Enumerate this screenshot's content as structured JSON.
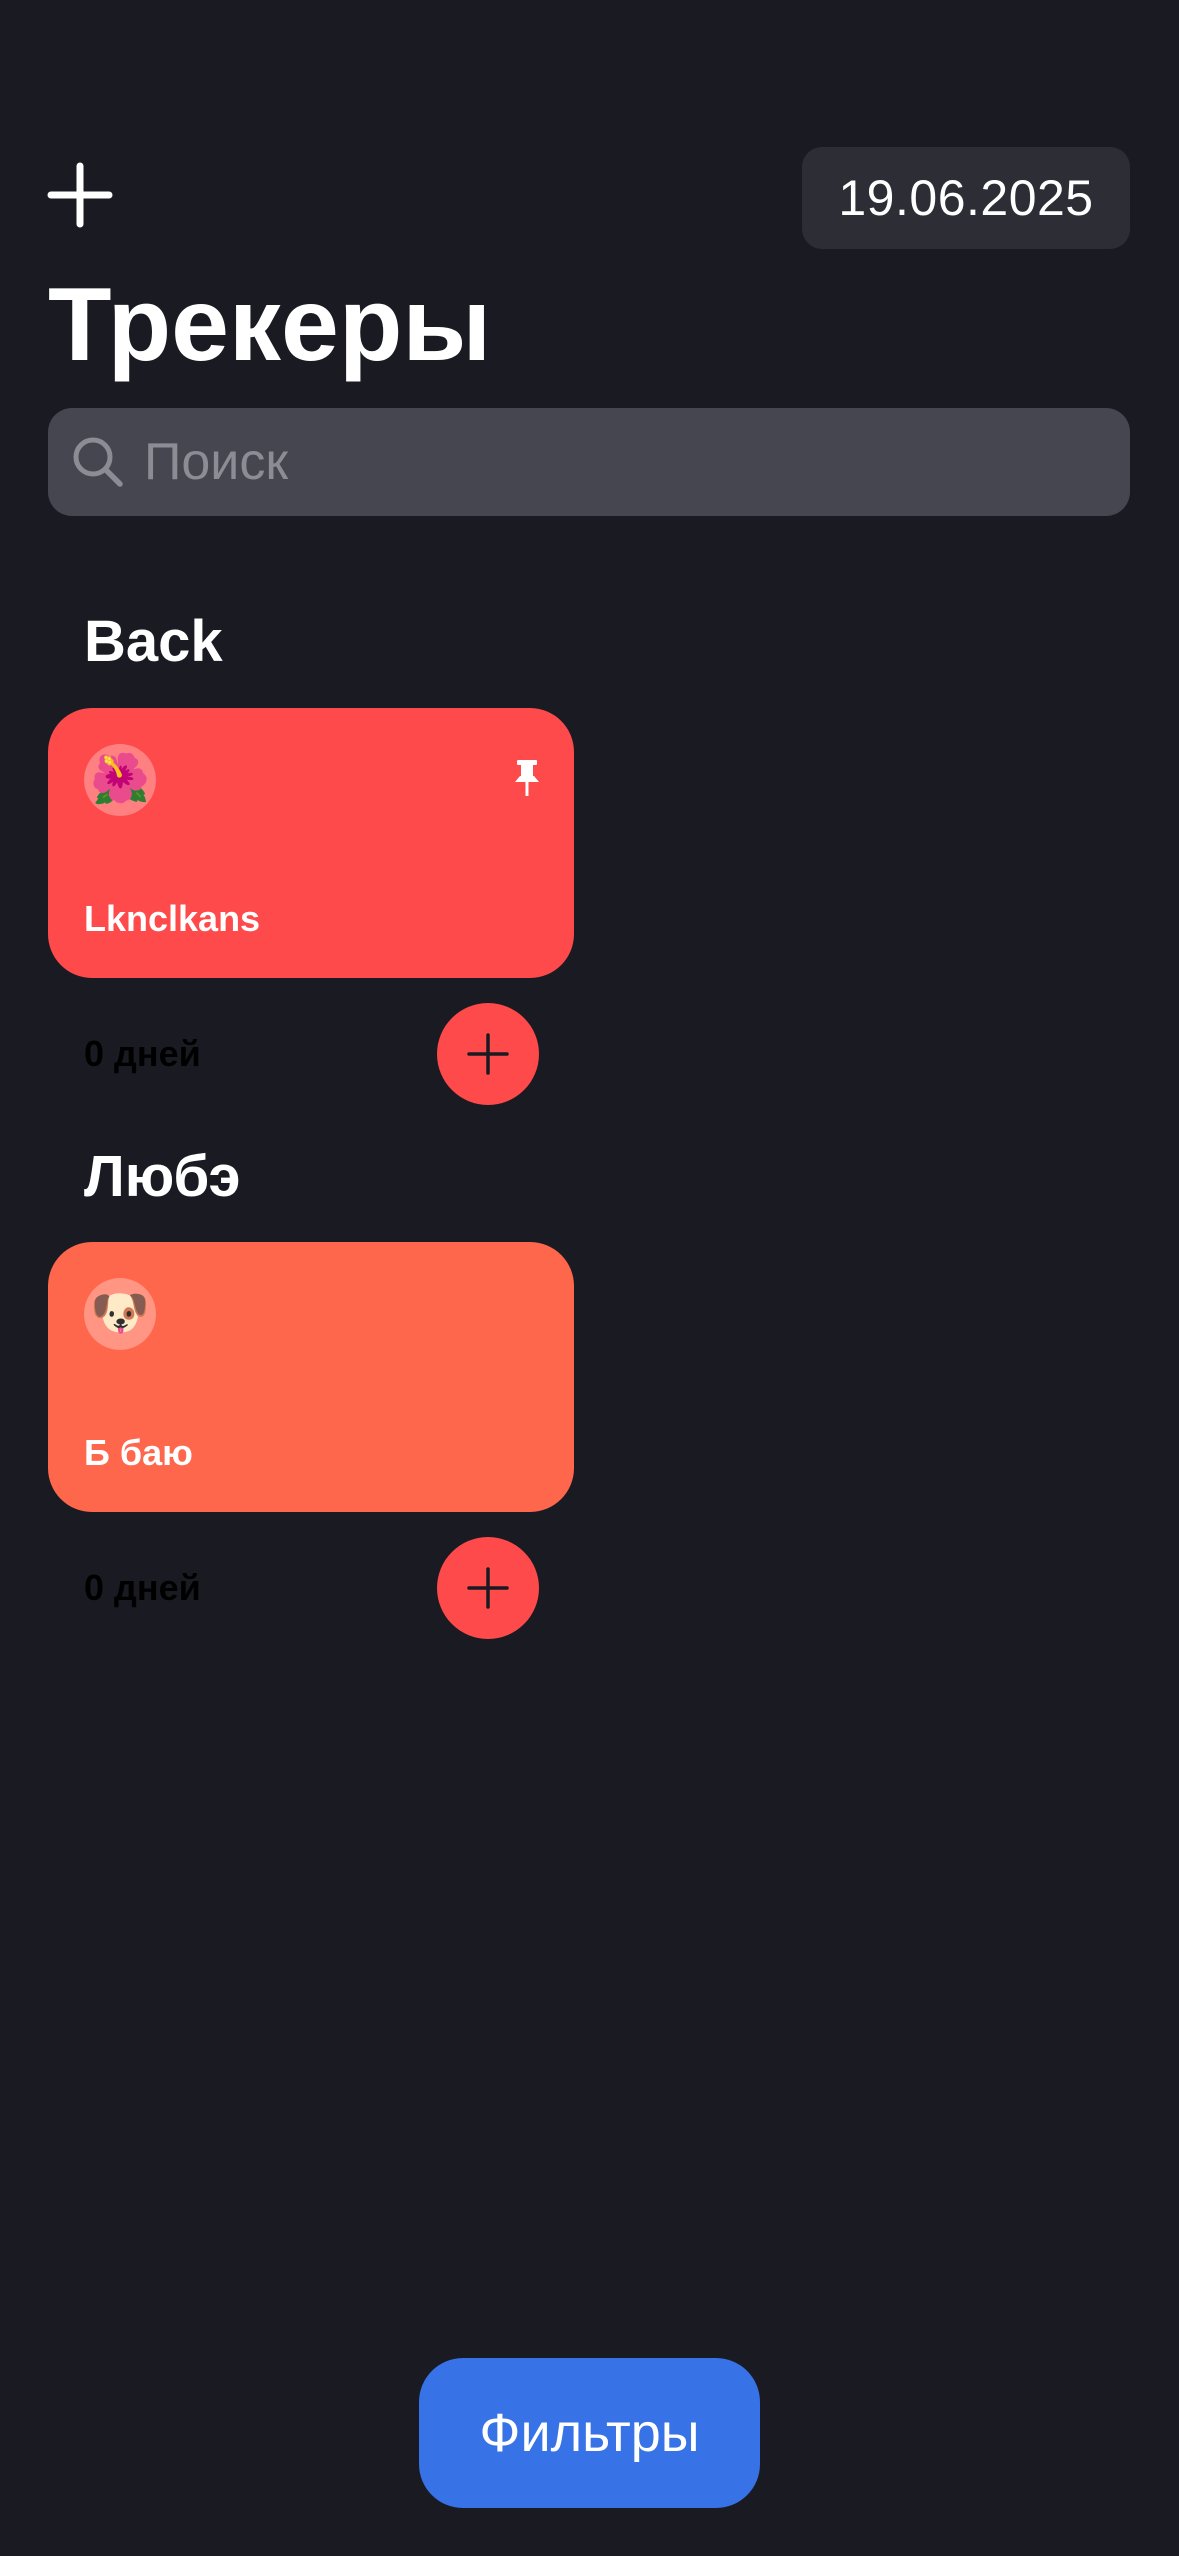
{
  "header": {
    "add_icon": "plus-icon",
    "date": "19.06.2025",
    "title": "Трекеры"
  },
  "search": {
    "icon": "magnifier-icon",
    "placeholder": "Поиск",
    "value": ""
  },
  "categories": [
    {
      "title": "Back",
      "trackers": [
        {
          "emoji": "🌺",
          "name": "Lknclkans",
          "pinned": true,
          "days": "0 дней",
          "color": "#fe4a4a"
        }
      ]
    },
    {
      "title": "Любэ",
      "trackers": [
        {
          "emoji": "🐶",
          "name": "Б баю",
          "pinned": false,
          "days": "0 дней",
          "color": "#ff674d"
        }
      ]
    }
  ],
  "filters_button": {
    "label": "Фильтры",
    "color": "#3772e7"
  }
}
